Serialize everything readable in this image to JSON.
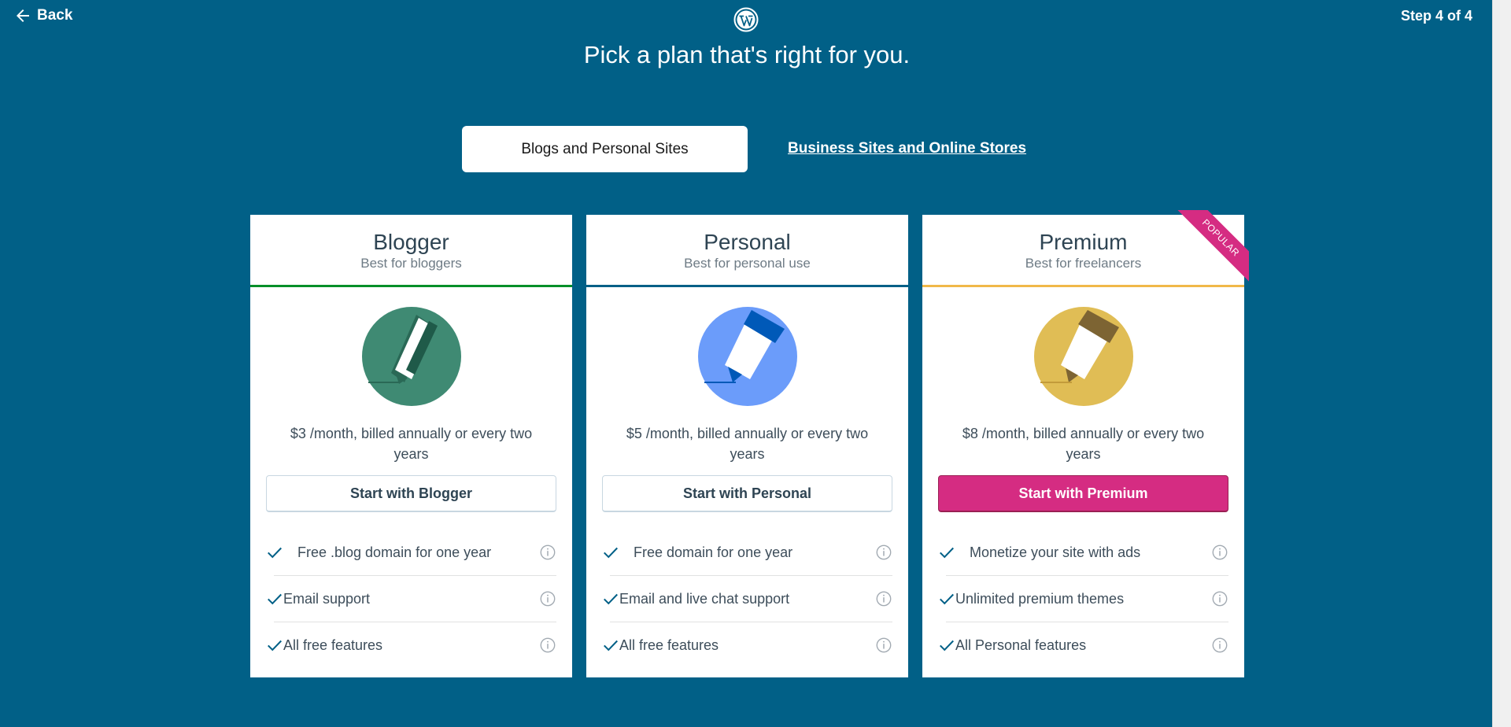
{
  "header": {
    "back_label": "Back",
    "step_label": "Step 4 of 4",
    "logo_icon": "wordpress-logo-icon",
    "headline": "Pick a plan that's right for you."
  },
  "tabs": {
    "active_label": "Blogs and Personal Sites",
    "other_label": "Business Sites and Online Stores"
  },
  "colors": {
    "background": "#016087",
    "blogger_accent": "#078f29",
    "personal_accent": "#016087",
    "premium_accent": "#f0b849",
    "premium_cta": "#d52c82"
  },
  "plans": [
    {
      "title": "Blogger",
      "subtitle": "Best for bloggers",
      "icon": "pencil-green-icon",
      "price": "$3 /month, billed annually or every two years",
      "cta": "Start with Blogger",
      "features": [
        "Free .blog domain for one year",
        "Email support",
        "All free features"
      ]
    },
    {
      "title": "Personal",
      "subtitle": "Best for personal use",
      "icon": "pencil-blue-icon",
      "price": "$5 /month, billed annually or every two years",
      "cta": "Start with Personal",
      "features": [
        "Free domain for one year",
        "Email and live chat support",
        "All free features"
      ]
    },
    {
      "title": "Premium",
      "subtitle": "Best for freelancers",
      "icon": "pencil-yellow-icon",
      "price": "$8 /month, billed annually or every two years",
      "cta": "Start with Premium",
      "badge": "POPULAR",
      "features": [
        "Monetize your site with ads",
        "Unlimited premium themes",
        "All Personal features"
      ]
    }
  ]
}
